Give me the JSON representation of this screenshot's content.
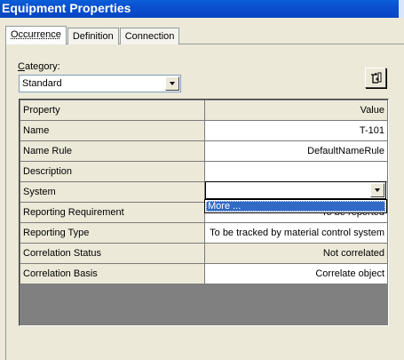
{
  "window": {
    "title": "Equipment Properties"
  },
  "tabs": [
    {
      "label": "Occurrence",
      "active": true
    },
    {
      "label": "Definition",
      "active": false
    },
    {
      "label": "Connection",
      "active": false
    }
  ],
  "category": {
    "label_prefix": "C",
    "label_rest": "ategory:",
    "value": "Standard"
  },
  "toolbar": {
    "icon": "properties-tool-icon"
  },
  "grid": {
    "header": {
      "property": "Property",
      "value": "Value"
    },
    "rows": [
      {
        "property": "Name",
        "value": "T-101"
      },
      {
        "property": "Name Rule",
        "value": "DefaultNameRule"
      },
      {
        "property": "Description",
        "value": ""
      },
      {
        "property": "System",
        "value": ""
      },
      {
        "property": "Reporting Requirement",
        "value": "To be reported"
      },
      {
        "property": "Reporting Type",
        "value": "To be tracked by material control system"
      },
      {
        "property": "Correlation Status",
        "value": "Not correlated"
      },
      {
        "property": "Correlation Basis",
        "value": "Correlate object"
      }
    ]
  },
  "system_dropdown": {
    "options": [
      "More ..."
    ],
    "selected": "More ..."
  },
  "colors": {
    "titlebar": "#0a4fd0",
    "selection": "#316ac5",
    "dialog": "#ece9d8",
    "grid_empty": "#808080"
  }
}
